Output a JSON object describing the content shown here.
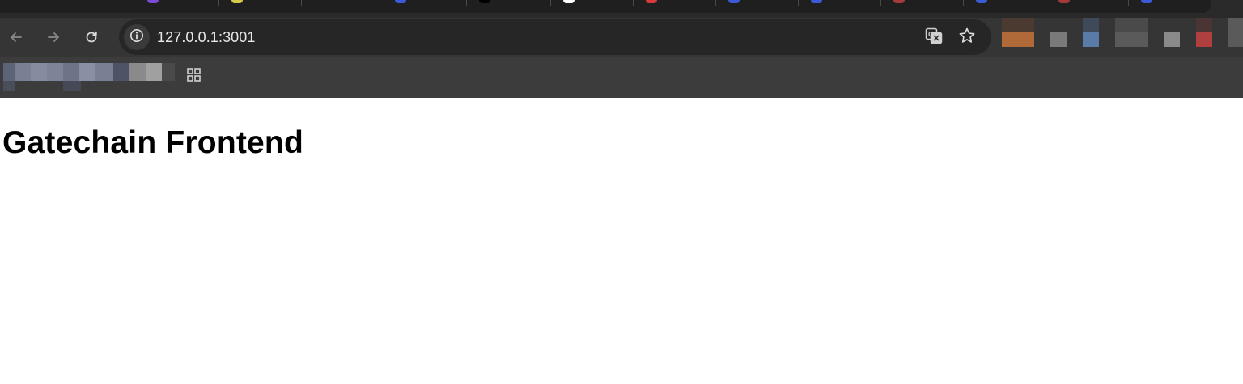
{
  "browser": {
    "url": "127.0.0.1:3001",
    "icons": {
      "back": "arrow-left-icon",
      "forward": "arrow-right-icon",
      "reload": "reload-icon",
      "site_info": "info-icon",
      "translate": "translate-icon",
      "bookmark": "star-icon",
      "apps": "apps-grid-icon"
    }
  },
  "page": {
    "heading": "Gatechain Frontend"
  },
  "colors": {
    "toolbar_bg": "#353535",
    "omnibox_bg": "#262626",
    "page_bg": "#ffffff",
    "heading_text": "#000000"
  }
}
